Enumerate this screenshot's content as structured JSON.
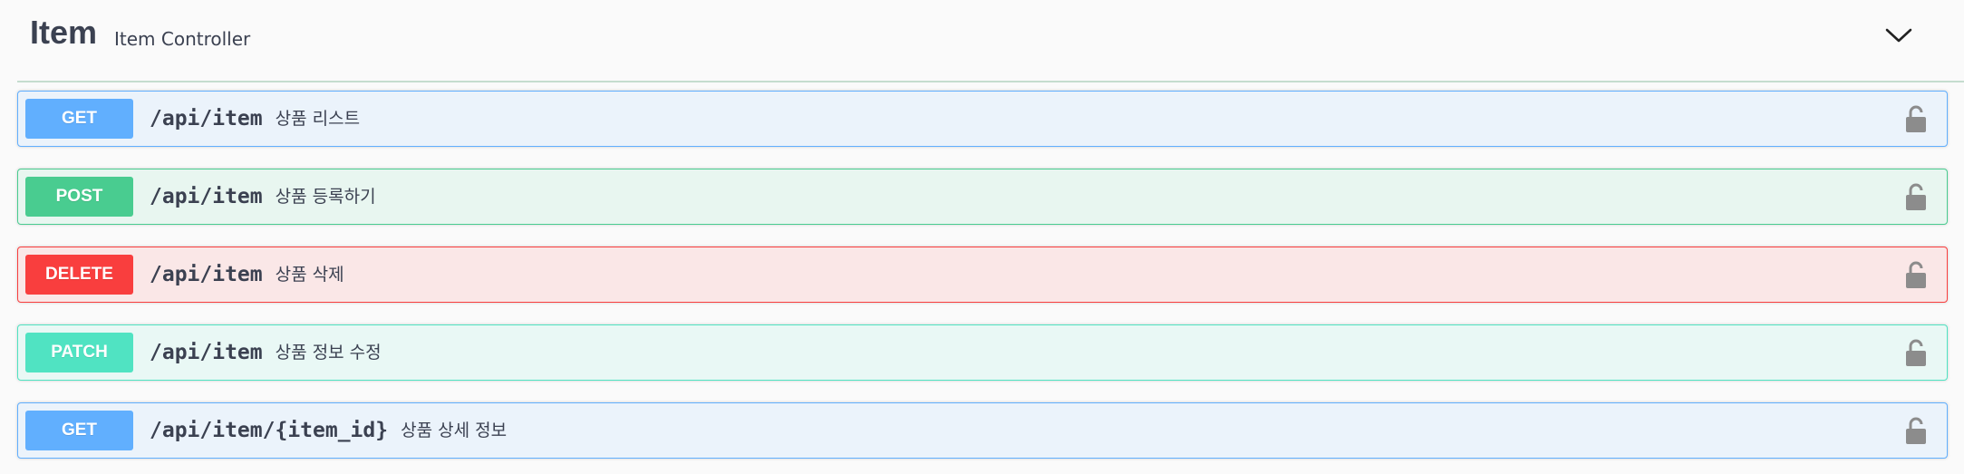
{
  "tag": {
    "title": "Item",
    "description": "Item Controller"
  },
  "operations": [
    {
      "method": "GET",
      "path": "/api/item",
      "summary": "상품 리스트",
      "bg": "#ebf3fb",
      "border": "#61affe",
      "badge": "#61affe"
    },
    {
      "method": "POST",
      "path": "/api/item",
      "summary": "상품 등록하기",
      "bg": "#e8f6f0",
      "border": "#49cc90",
      "badge": "#49cc90"
    },
    {
      "method": "DELETE",
      "path": "/api/item",
      "summary": "상품 삭제",
      "bg": "#fae7e7",
      "border": "#f93e3e",
      "badge": "#f93e3e"
    },
    {
      "method": "PATCH",
      "path": "/api/item",
      "summary": "상품 정보 수정",
      "bg": "#e9f8f5",
      "border": "#50e3c2",
      "badge": "#50e3c2"
    },
    {
      "method": "GET",
      "path": "/api/item/{item_id}",
      "summary": "상품 상세 정보",
      "bg": "#ebf3fb",
      "border": "#61affe",
      "badge": "#61affe"
    }
  ],
  "icons": {
    "expand": "chevron-down-icon",
    "lock": "lock-icon"
  },
  "colors": {
    "text": "#3b4151",
    "lock": "#8c8c8c",
    "divider": "#c5ddcf"
  }
}
